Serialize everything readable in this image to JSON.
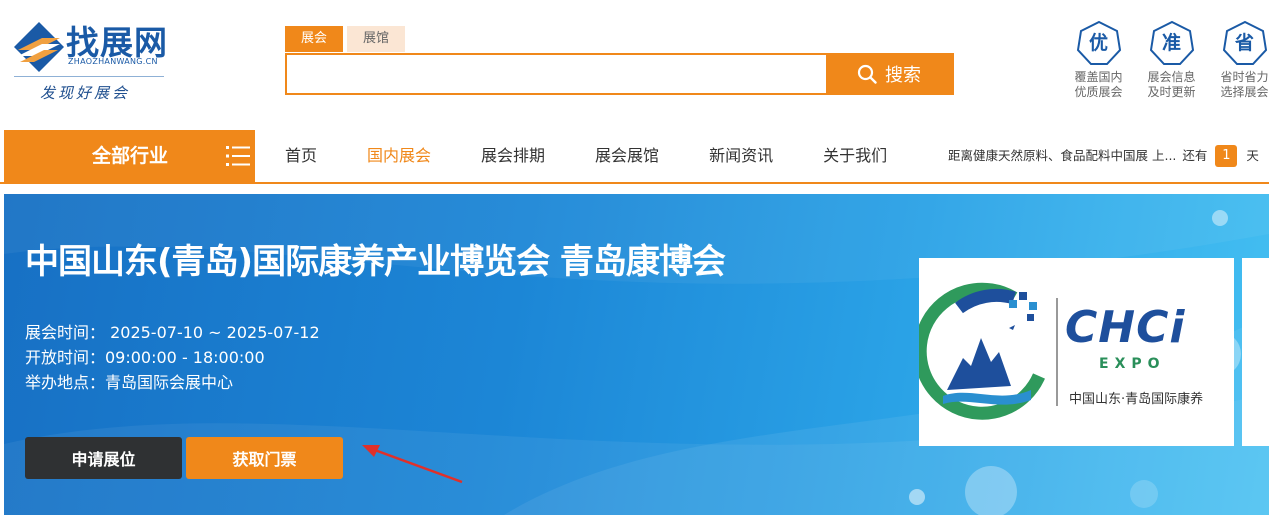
{
  "logo": {
    "name": "找展网",
    "sub": "ZHAOZHANWANG.CN",
    "slogan": "发现好展会"
  },
  "search": {
    "tabs": [
      {
        "label": "展会",
        "active": true
      },
      {
        "label": "展馆",
        "active": false
      }
    ],
    "placeholder": "",
    "value": "",
    "button_label": "搜索"
  },
  "features": [
    {
      "badge": "优",
      "line1": "覆盖国内",
      "line2": "优质展会"
    },
    {
      "badge": "准",
      "line1": "展会信息",
      "line2": "及时更新"
    },
    {
      "badge": "省",
      "line1": "省时省力",
      "line2": "选择展会"
    }
  ],
  "nav": {
    "all_industries": "全部行业",
    "items": [
      {
        "label": "首页",
        "active": false
      },
      {
        "label": "国内展会",
        "active": true
      },
      {
        "label": "展会排期",
        "active": false
      },
      {
        "label": "展会展馆",
        "active": false
      },
      {
        "label": "新闻资讯",
        "active": false
      },
      {
        "label": "关于我们",
        "active": false
      }
    ],
    "countdown": {
      "prefix": "距离健康天然原料、食品配料中国展 上...",
      "middle": "还有",
      "days": "1",
      "suffix": "天"
    }
  },
  "expo": {
    "title": "中国山东(青岛)国际康养产业博览会 青岛康博会",
    "date_line": "展会时间： 2025-07-10 ~ 2025-07-12",
    "hours_line": "开放时间：09:00:00 - 18:00:00",
    "venue_line": "举办地点：青岛国际会展中心",
    "apply_button": "申请展位",
    "ticket_button": "获取门票",
    "poster": {
      "brand": "CHCi",
      "sub_brand": "EXPO",
      "caption": "中国山东·青岛国际康养"
    }
  },
  "colors": {
    "accent": "#f0881a",
    "brand_blue": "#1a5aa6",
    "dark_button": "#2f3133"
  }
}
